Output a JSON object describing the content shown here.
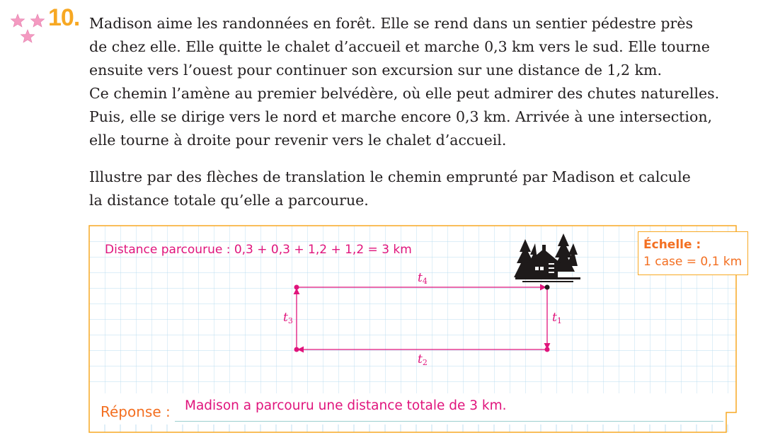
{
  "exercise": {
    "number": "10.",
    "difficulty_stars": 3,
    "star_color": "#f49ac1",
    "number_color": "#f7a823"
  },
  "statement": {
    "lines": [
      "Madison aime les randonnées en forêt. Elle se rend dans un sentier pédestre près",
      "de chez elle. Elle quitte le chalet d’accueil et marche 0,3 km vers le sud. Elle tourne",
      "ensuite vers l’ouest pour continuer son excursion sur une distance de 1,2 km.",
      "Ce chemin l’amène au premier belvédère, où elle peut admirer des chutes naturelles.",
      "Puis, elle se dirige vers le nord et marche encore 0,3 km. Arrivée à une intersection,",
      "elle tourne à droite pour revenir vers le chalet d’accueil."
    ]
  },
  "question": {
    "lines": [
      "Illustre par des flèches de translation le chemin emprunté par Madison et calcule",
      "la distance totale qu’elle a parcourue."
    ]
  },
  "work": {
    "distance_text": "Distance parcourue : 0,3 + 0,3 + 1,2 + 1,2 = 3 km",
    "cabin_icon": "cabin-in-forest-icon",
    "vectors": [
      {
        "letter": "t",
        "sub": "1",
        "direction": "sud",
        "km": 0.3
      },
      {
        "letter": "t",
        "sub": "2",
        "direction": "ouest",
        "km": 1.2
      },
      {
        "letter": "t",
        "sub": "3",
        "direction": "nord",
        "km": 0.3
      },
      {
        "letter": "t",
        "sub": "4",
        "direction": "est",
        "km": 1.2
      }
    ],
    "answer_color": "#e0147c",
    "grid_color": "#b9dcf0"
  },
  "scale": {
    "title": "Échelle :",
    "value": "1 case = 0,1 km"
  },
  "reponse": {
    "label": "Réponse :",
    "answer": "Madison a parcouru une distance totale de 3 km."
  }
}
